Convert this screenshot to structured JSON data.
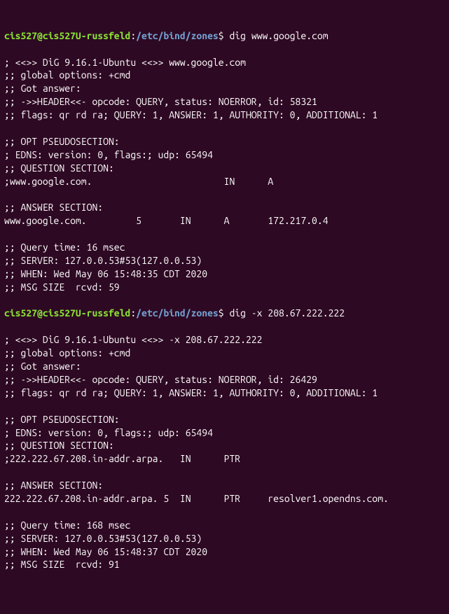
{
  "prompt1": {
    "userhost": "cis527@cis527U-russfeld",
    "colon": ":",
    "path": "/etc/bind/zones",
    "dollar": "$ ",
    "command": "dig www.google.com"
  },
  "output1": [
    "",
    "; <<>> DiG 9.16.1-Ubuntu <<>> www.google.com",
    ";; global options: +cmd",
    ";; Got answer:",
    ";; ->>HEADER<<- opcode: QUERY, status: NOERROR, id: 58321",
    ";; flags: qr rd ra; QUERY: 1, ANSWER: 1, AUTHORITY: 0, ADDITIONAL: 1",
    "",
    ";; OPT PSEUDOSECTION:",
    "; EDNS: version: 0, flags:; udp: 65494",
    ";; QUESTION SECTION:",
    ";www.google.com.                        IN      A",
    "",
    ";; ANSWER SECTION:",
    "www.google.com.         5       IN      A       172.217.0.4",
    "",
    ";; Query time: 16 msec",
    ";; SERVER: 127.0.0.53#53(127.0.0.53)",
    ";; WHEN: Wed May 06 15:48:35 CDT 2020",
    ";; MSG SIZE  rcvd: 59",
    ""
  ],
  "prompt2": {
    "userhost": "cis527@cis527U-russfeld",
    "colon": ":",
    "path": "/etc/bind/zones",
    "dollar": "$ ",
    "command": "dig -x 208.67.222.222"
  },
  "output2": [
    "",
    "; <<>> DiG 9.16.1-Ubuntu <<>> -x 208.67.222.222",
    ";; global options: +cmd",
    ";; Got answer:",
    ";; ->>HEADER<<- opcode: QUERY, status: NOERROR, id: 26429",
    ";; flags: qr rd ra; QUERY: 1, ANSWER: 1, AUTHORITY: 0, ADDITIONAL: 1",
    "",
    ";; OPT PSEUDOSECTION:",
    "; EDNS: version: 0, flags:; udp: 65494",
    ";; QUESTION SECTION:",
    ";222.222.67.208.in-addr.arpa.   IN      PTR",
    "",
    ";; ANSWER SECTION:",
    "222.222.67.208.in-addr.arpa. 5  IN      PTR     resolver1.opendns.com.",
    "",
    ";; Query time: 168 msec",
    ";; SERVER: 127.0.0.53#53(127.0.0.53)",
    ";; WHEN: Wed May 06 15:48:37 CDT 2020",
    ";; MSG SIZE  rcvd: 91"
  ]
}
